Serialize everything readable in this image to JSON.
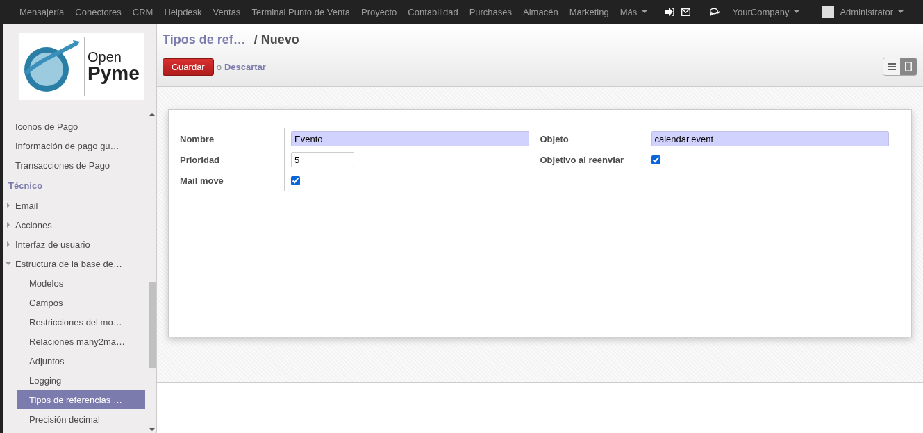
{
  "navbar": {
    "apps": [
      "Mensajería",
      "Conectores",
      "CRM",
      "Helpdesk",
      "Ventas",
      "Terminal Punto de Venta",
      "Proyecto",
      "Contabilidad",
      "Purchases",
      "Almacén",
      "Marketing"
    ],
    "more": "Más",
    "company": "YourCompany",
    "user": "Administrator"
  },
  "sidebar": {
    "logo": {
      "top": "Open",
      "bottom": "Pyme"
    },
    "items": [
      {
        "kind": "item",
        "label": "Iconos de Pago",
        "selected": false
      },
      {
        "kind": "item",
        "label": "Información de pago gu…",
        "selected": false
      },
      {
        "kind": "item",
        "label": "Transacciones de Pago",
        "selected": false
      },
      {
        "kind": "section",
        "label": "Técnico"
      },
      {
        "kind": "folder",
        "label": "Email",
        "expanded": false
      },
      {
        "kind": "folder",
        "label": "Acciones",
        "expanded": false
      },
      {
        "kind": "folder",
        "label": "Interfaz de usuario",
        "expanded": false
      },
      {
        "kind": "folder",
        "label": "Estructura de la base de…",
        "expanded": true,
        "children": [
          {
            "label": "Modelos",
            "selected": false
          },
          {
            "label": "Campos",
            "selected": false
          },
          {
            "label": "Restricciones del mo…",
            "selected": false
          },
          {
            "label": "Relaciones many2ma…",
            "selected": false
          },
          {
            "label": "Adjuntos",
            "selected": false
          },
          {
            "label": "Logging",
            "selected": false
          },
          {
            "label": "Tipos de referencias …",
            "selected": true
          },
          {
            "label": "Precisión decimal",
            "selected": false
          }
        ]
      }
    ]
  },
  "breadcrumb": {
    "parent": "Tipos de ref…",
    "current": "/ Nuevo"
  },
  "actions": {
    "save": "Guardar",
    "or": "o",
    "discard": "Descartar"
  },
  "views": [
    {
      "kind": "list",
      "selected": false
    },
    {
      "kind": "form",
      "selected": true
    }
  ],
  "form": {
    "left": [
      {
        "kind": "text",
        "label": "Nombre",
        "value": "Evento",
        "required": true
      },
      {
        "kind": "text",
        "label": "Prioridad",
        "value": "5",
        "required": false
      },
      {
        "kind": "check",
        "label": "Mail move",
        "checked": true
      }
    ],
    "right": [
      {
        "kind": "text",
        "label": "Objeto",
        "value": "calendar.event",
        "required": true
      },
      {
        "kind": "check",
        "label": "Objetivo al reenviar",
        "checked": true
      }
    ]
  }
}
